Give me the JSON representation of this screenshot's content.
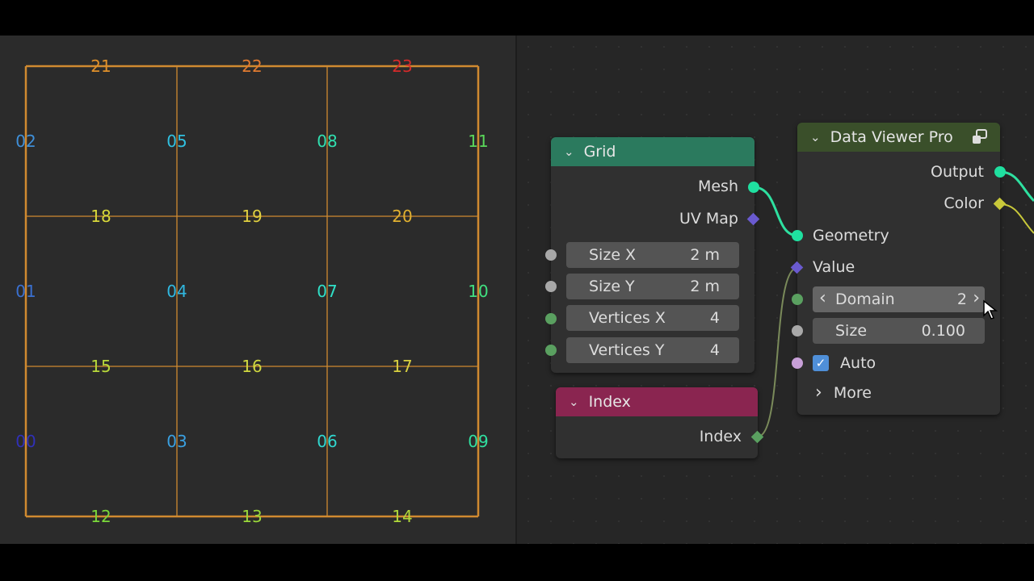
{
  "viewport": {
    "vertex_labels": [
      {
        "text": "21",
        "color": "#e0902a"
      },
      {
        "text": "22",
        "color": "#e07a30"
      },
      {
        "text": "23",
        "color": "#d42a2a"
      },
      {
        "text": "02",
        "color": "#3f8fd8"
      },
      {
        "text": "05",
        "color": "#30c0e0"
      },
      {
        "text": "08",
        "color": "#30e0b0"
      },
      {
        "text": "11",
        "color": "#5ad85a"
      },
      {
        "text": "18",
        "color": "#d8d83a"
      },
      {
        "text": "19",
        "color": "#e0d040"
      },
      {
        "text": "20",
        "color": "#e0b030"
      },
      {
        "text": "01",
        "color": "#3a70d0"
      },
      {
        "text": "04",
        "color": "#30b8e0"
      },
      {
        "text": "07",
        "color": "#30e0c8"
      },
      {
        "text": "10",
        "color": "#40e080"
      },
      {
        "text": "15",
        "color": "#b8d83a"
      },
      {
        "text": "16",
        "color": "#d0d840"
      },
      {
        "text": "17",
        "color": "#d8d040"
      },
      {
        "text": "00",
        "color": "#3030b8"
      },
      {
        "text": "03",
        "color": "#3aa0e0"
      },
      {
        "text": "06",
        "color": "#30d8d0"
      },
      {
        "text": "09",
        "color": "#30e0a0"
      },
      {
        "text": "12",
        "color": "#7ad83a"
      },
      {
        "text": "13",
        "color": "#9ad83a"
      },
      {
        "text": "14",
        "color": "#b0d83a"
      }
    ],
    "edge_color": "#d08a30"
  },
  "grid_node": {
    "title": "Grid",
    "header_color": "#2b7a5e",
    "outputs": [
      "Mesh",
      "UV Map"
    ],
    "fields": [
      {
        "label": "Size X",
        "value": "2 m"
      },
      {
        "label": "Size Y",
        "value": "2 m"
      },
      {
        "label": "Vertices X",
        "value": "4"
      },
      {
        "label": "Vertices Y",
        "value": "4"
      }
    ]
  },
  "index_node": {
    "title": "Index",
    "header_color": "#8a2550",
    "output": "Index"
  },
  "viewer_node": {
    "title": "Data Viewer Pro",
    "header_color": "#3a4f2a",
    "outputs": [
      "Output",
      "Color"
    ],
    "inputs": [
      "Geometry",
      "Value"
    ],
    "domain": {
      "label": "Domain",
      "value": "2",
      "prev": "‹",
      "next": "›"
    },
    "size": {
      "label": "Size",
      "value": "0.100"
    },
    "auto": {
      "label": "Auto",
      "checked": true,
      "check_glyph": "✓"
    },
    "more": {
      "label": "More",
      "chevron": "›"
    },
    "header_icon": "viewer-node-icon"
  },
  "icons": {
    "collapse_chevron": "⌄"
  }
}
